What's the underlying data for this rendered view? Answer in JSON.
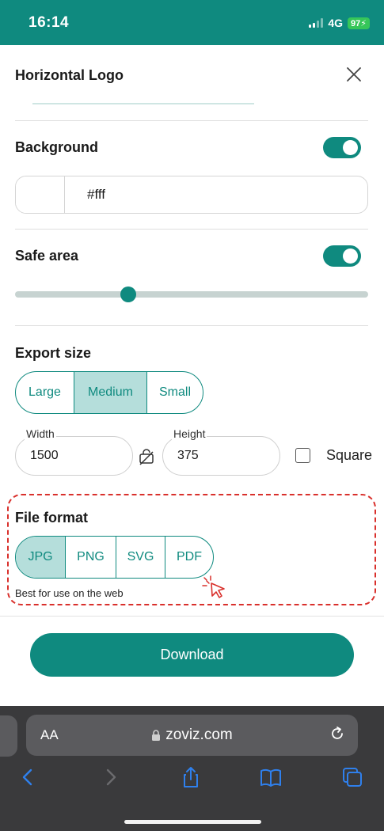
{
  "status_bar": {
    "time": "16:14",
    "network": "4G",
    "battery": "97"
  },
  "sheet": {
    "title": "Horizontal Logo",
    "close_icon": "close-icon"
  },
  "background": {
    "label": "Background",
    "enabled": true,
    "color_value": "#fff",
    "swatch_color": "#ffffff"
  },
  "safe_area": {
    "label": "Safe area",
    "enabled": true,
    "level": 0.32
  },
  "export_size": {
    "label": "Export size",
    "options": [
      "Large",
      "Medium",
      "Small"
    ],
    "selected": "Medium",
    "width_label": "Width",
    "width_value": "1500",
    "height_label": "Height",
    "height_value": "375",
    "link_icon": "unlink-ratio-icon",
    "square_label": "Square",
    "square_checked": false
  },
  "file_format": {
    "label": "File format",
    "options": [
      "JPG",
      "PNG",
      "SVG",
      "PDF"
    ],
    "selected": "JPG",
    "hint": "Best for use on the web",
    "cursor_icon": "pointer-click-icon"
  },
  "download": {
    "label": "Download"
  },
  "browser": {
    "aa_label": "AA",
    "url": "zoviz.com",
    "lock_icon": "lock-icon",
    "reload_icon": "reload-icon",
    "toolbar_icons": [
      "back-icon",
      "forward-icon",
      "share-icon",
      "bookmarks-icon",
      "tabs-icon"
    ]
  },
  "colors": {
    "accent": "#0f8a7f",
    "accent_light": "#b5dedb",
    "highlight": "#d9302c",
    "browser_bg": "#3a3a3c"
  }
}
